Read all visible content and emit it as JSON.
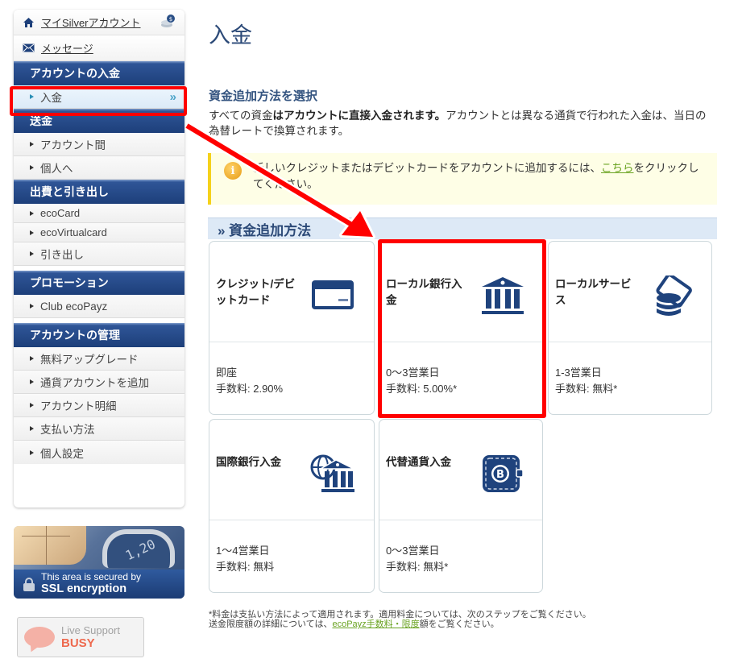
{
  "sidebar": {
    "top_links": [
      {
        "label": "マイSilverアカウント",
        "icon": "home-icon",
        "right_icon": "coins-icon"
      },
      {
        "label": "メッセージ",
        "icon": "envelope-icon"
      }
    ],
    "sections": [
      {
        "title": "アカウントの入金",
        "items": [
          {
            "label": "入金",
            "active": true
          }
        ]
      },
      {
        "title": "送金",
        "items": [
          {
            "label": "アカウント間"
          },
          {
            "label": "個人へ"
          }
        ]
      },
      {
        "title": "出費と引き出し",
        "items": [
          {
            "label": "ecoCard"
          },
          {
            "label": "ecoVirtualcard"
          },
          {
            "label": "引き出し"
          }
        ]
      },
      {
        "title": "プロモーション",
        "items": [
          {
            "label": "Club ecoPayz"
          }
        ]
      },
      {
        "title": "アカウントの管理",
        "items": [
          {
            "label": "無料アップグレード"
          },
          {
            "label": "通貨アカウントを追加"
          },
          {
            "label": "アカウント明細"
          },
          {
            "label": "支払い方法"
          },
          {
            "label": "個人設定"
          }
        ]
      }
    ],
    "active_chevron": "»"
  },
  "ssl_banner": {
    "line1": "This area is secured by",
    "line2": "SSL encryption",
    "card_digits": "1,20"
  },
  "live_support": {
    "line1": "Live Support",
    "status": "BUSY"
  },
  "main": {
    "title": "入金",
    "subheading": "資金追加方法を選択",
    "intro": {
      "part1": "すべての資金",
      "bold": "はアカウントに直接入金されます。",
      "part2": "アカウントとは異なる通貨で行われた入金は、当日の為替レートで換算されます。"
    },
    "info_box": {
      "icon": "info-icon",
      "before_link": "新しいクレジットまたはデビットカードをアカウントに追加するには、",
      "link": "こちら",
      "after_link": "をクリックしてください。"
    },
    "methods_heading": "» 資金追加方法",
    "methods": [
      {
        "title": "クレジット/デビットカード",
        "icon": "credit-card-icon",
        "time": "即座",
        "fee": "手数料: 2.90%"
      },
      {
        "title": "ローカル銀行入金",
        "icon": "bank-icon",
        "time": "0〜3営業日",
        "fee": "手数料: 5.00%*",
        "highlighted": true
      },
      {
        "title": "ローカルサービス",
        "icon": "cash-coins-icon",
        "time": "1-3営業日",
        "fee": "手数料: 無料*"
      },
      {
        "title": "国際銀行入金",
        "icon": "global-bank-icon",
        "time": "1〜4営業日",
        "fee": "手数料: 無料"
      },
      {
        "title": "代替通貨入金",
        "icon": "bitcoin-wallet-icon",
        "time": "0〜3営業日",
        "fee": "手数料: 無料*"
      }
    ],
    "footnote": {
      "line1": "*料金は支払い方法によって適用されます。適用料金については、次のステップをご覧ください。",
      "line2_before": "送金限度額の詳細については、",
      "line2_link": "ecoPayz手数料・限度",
      "line2_after": "額をご覧ください。"
    }
  },
  "annotation": {
    "color": "#ff0000"
  }
}
